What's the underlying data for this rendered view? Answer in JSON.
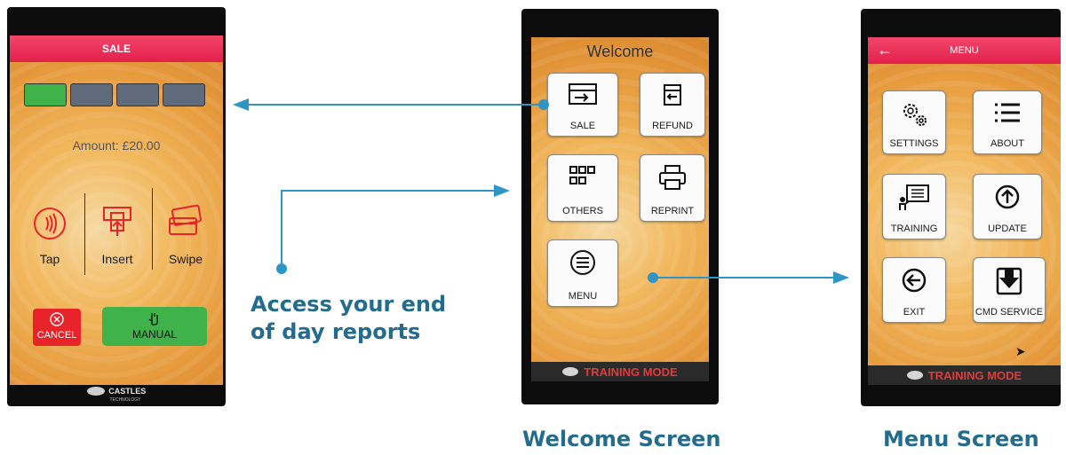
{
  "sale_screen": {
    "title": "SALE",
    "amount_label": "Amount: £20.00",
    "methods": [
      "Tap",
      "Insert",
      "Swipe"
    ],
    "cancel_label": "CANCEL",
    "manual_label": "MANUAL",
    "footer_brand": "CASTLES",
    "footer_brand_sub": "TECHNOLOGY",
    "indicator_colors": [
      "#3fb24a",
      "#5f6b7a",
      "#5f6b7a",
      "#5f6b7a"
    ]
  },
  "welcome_screen": {
    "title": "Welcome",
    "buttons": [
      "SALE",
      "REFUND",
      "OTHERS",
      "REPRINT",
      "MENU"
    ],
    "footer": "TRAINING MODE"
  },
  "menu_screen": {
    "title": "MENU",
    "back_icon": "back-arrow-icon",
    "buttons": [
      "SETTINGS",
      "ABOUT",
      "TRAINING",
      "UPDATE",
      "EXIT",
      "CMD SERVICE"
    ],
    "footer": "TRAINING MODE",
    "next_icon": "chevron-right-icon"
  },
  "annotations": {
    "callout_line1": "Access your end",
    "callout_line2": "of day reports",
    "welcome_caption": "Welcome Screen",
    "menu_caption": "Menu Screen"
  },
  "colors": {
    "caption": "#236c8e",
    "arrow": "#2e95c4",
    "header_red": "#e2204c",
    "manual_green": "#3fb24a",
    "cancel_red": "#e8232a"
  }
}
